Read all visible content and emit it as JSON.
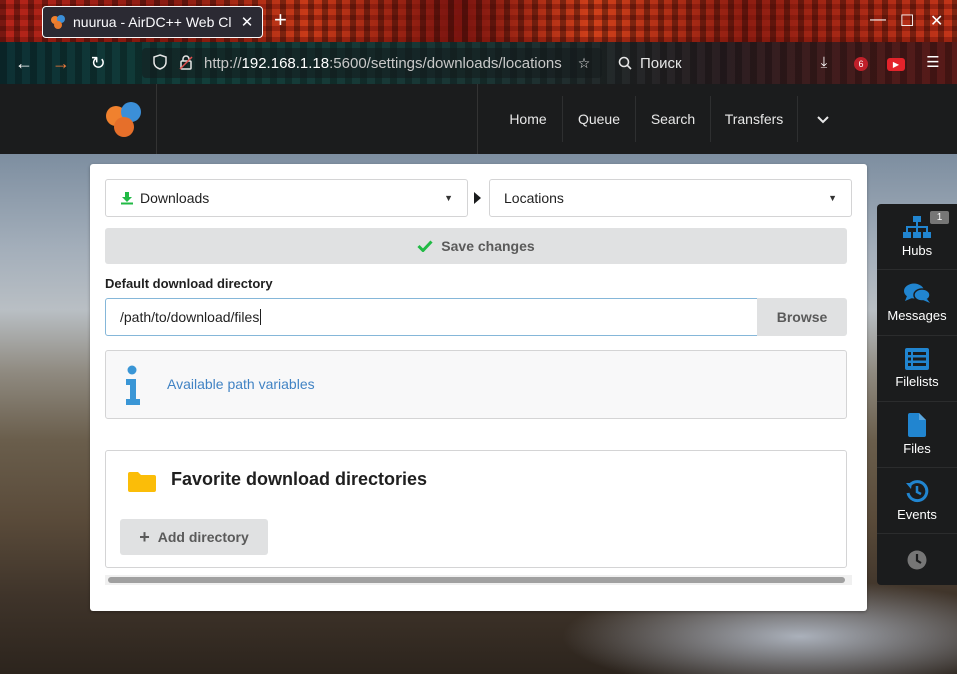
{
  "browser": {
    "tab_title": "nuurua - AirDC++ Web Client",
    "url_prefix": "http://",
    "url_host": "192.168.1.18",
    "url_rest": ":5600/settings/downloads/locations",
    "search_placeholder": "Поиск",
    "extension_badge": "6"
  },
  "nav": {
    "items": [
      {
        "label": "Home"
      },
      {
        "label": "Queue"
      },
      {
        "label": "Search"
      },
      {
        "label": "Transfers"
      }
    ]
  },
  "settings": {
    "section_dropdown": "Downloads",
    "page_dropdown": "Locations",
    "save_label": "Save changes",
    "field_label": "Default download directory",
    "field_value": "/path/to/download/files",
    "browse_label": "Browse",
    "info_link": "Available path variables",
    "favorites_title": "Favorite download directories",
    "add_label": "Add directory"
  },
  "sidebar": {
    "items": [
      {
        "label": "Hubs",
        "badge": "1",
        "icon": "sitemap-icon"
      },
      {
        "label": "Messages",
        "icon": "comments-icon"
      },
      {
        "label": "Filelists",
        "icon": "list-icon"
      },
      {
        "label": "Files",
        "icon": "file-icon"
      },
      {
        "label": "Events",
        "icon": "history-icon"
      },
      {
        "label": "",
        "icon": "clock-icon"
      }
    ]
  },
  "colors": {
    "accent_blue": "#2185d0",
    "link_blue": "#4183c4",
    "success_green": "#21ba45",
    "header_dark": "#1b1c1d"
  }
}
